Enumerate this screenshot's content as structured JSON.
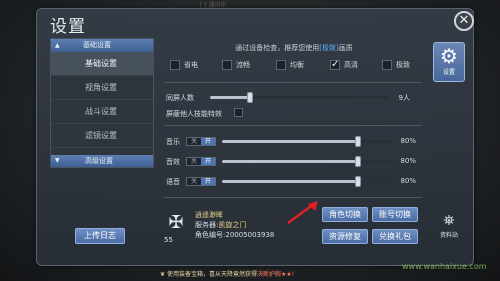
{
  "top_strip": "[ ] 通讯中",
  "title": "设置",
  "sidebar": {
    "header": "基础设置",
    "items": [
      {
        "label": "基础设置",
        "active": true
      },
      {
        "label": "视角设置",
        "active": false
      },
      {
        "label": "战斗设置",
        "active": false
      },
      {
        "label": "滤镜设置",
        "active": false
      }
    ],
    "footer": "高级设置"
  },
  "upload_log": "上传日志",
  "right_tabs": {
    "settings": "设置",
    "data_station": "资料站"
  },
  "hint": {
    "prefix": "通过设备检查，推荐您使用",
    "recommend": "[极致]",
    "suffix": "画质"
  },
  "quality_options": [
    {
      "label": "省电",
      "checked": false
    },
    {
      "label": "流畅",
      "checked": false
    },
    {
      "label": "均衡",
      "checked": false
    },
    {
      "label": "高清",
      "checked": true
    },
    {
      "label": "极致",
      "checked": false
    }
  ],
  "same_screen": {
    "label": "同屏人数",
    "value": "9人",
    "level": 0.22
  },
  "block_skill": {
    "label": "屏蔽他人技能特效"
  },
  "audio": [
    {
      "label": "音乐",
      "off": "关",
      "on": "开",
      "value": "80%",
      "level": 0.8
    },
    {
      "label": "音效",
      "off": "关",
      "on": "开",
      "value": "80%",
      "level": 0.8
    },
    {
      "label": "语音",
      "off": "关",
      "on": "开",
      "value": "80%",
      "level": 0.8
    }
  ],
  "profile": {
    "level": "55",
    "name": "逍遥渺眸",
    "server_label": "服务器:",
    "server": "凯旋之门",
    "id_label": "角色编号:",
    "id": "20005003938"
  },
  "buttons": {
    "switch_role": "角色切换",
    "switch_account": "账号切换",
    "resource_repair": "资源修复",
    "redeem_gift": "兑换礼包"
  },
  "bottom_bar": {
    "text": "使用装备宝箱，喜从天降竟然获得",
    "highlight": "决断护腕★★!"
  },
  "watermark": "www.wanhaixue.com",
  "colors": {
    "accent": "#4f76b3",
    "highlight": "#5cb0ff",
    "gold": "#e9d28a"
  }
}
